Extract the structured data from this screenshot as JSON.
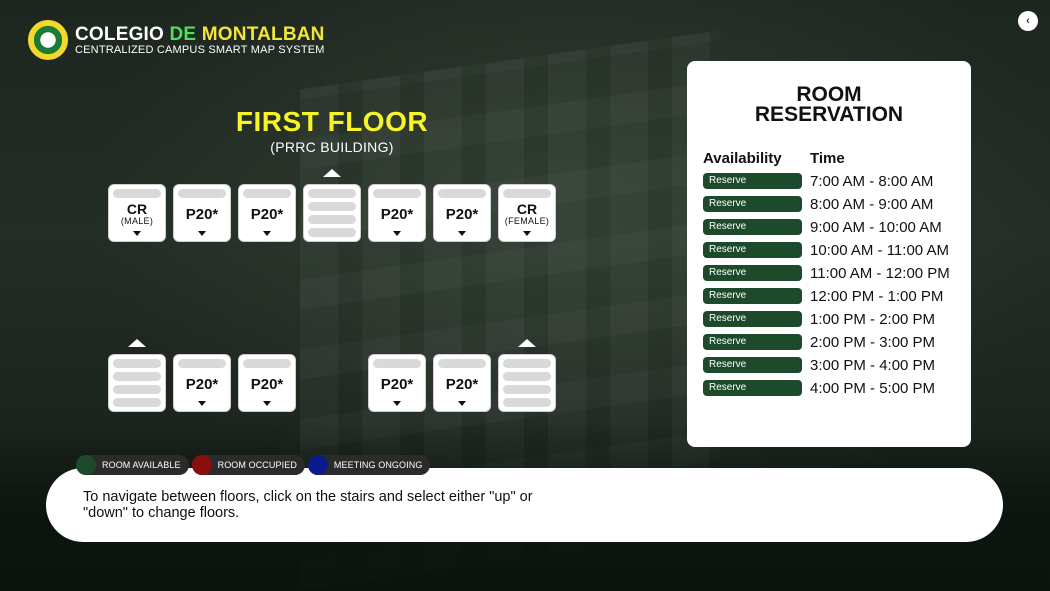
{
  "header": {
    "title_part1": "COLEGIO",
    "title_part2": "DE",
    "title_part3": "MONTALBAN",
    "subtitle": "CENTRALIZED CAMPUS SMART MAP SYSTEM",
    "logo_icon": "school-seal-icon"
  },
  "back_button": {
    "label": "‹",
    "icon": "chevron-left-icon"
  },
  "floor": {
    "name": "FIRST FLOOR",
    "building": "(PRRC BUILDING)"
  },
  "rooms_top": [
    {
      "label": "CR",
      "sub": "(MALE)"
    },
    {
      "label": "P20*"
    },
    {
      "label": "P20*"
    },
    {
      "label": "stairs"
    },
    {
      "label": "P20*"
    },
    {
      "label": "P20*"
    },
    {
      "label": "CR",
      "sub": "(FEMALE)"
    }
  ],
  "rooms_bottom": [
    {
      "label": "stairs"
    },
    {
      "label": "P20*"
    },
    {
      "label": "P20*"
    },
    {
      "label": "P20*"
    },
    {
      "label": "P20*"
    },
    {
      "label": "stairs"
    }
  ],
  "reservation": {
    "title_line1": "ROOM",
    "title_line2": "RESERVATION",
    "col_availability": "Availability",
    "col_time": "Time",
    "button_label": "Reserve",
    "slots": [
      "7:00 AM - 8:00 AM",
      "8:00 AM - 9:00 AM",
      "9:00 AM - 10:00 AM",
      "10:00 AM - 11:00 AM",
      "11:00 AM - 12:00 PM",
      "12:00 PM - 1:00 PM",
      "1:00 PM - 2:00 PM",
      "2:00 PM - 3:00 PM",
      "3:00 PM - 4:00 PM",
      "4:00 PM - 5:00 PM"
    ]
  },
  "legend": [
    {
      "label": "ROOM AVAILABLE",
      "color": "#1e4a2c"
    },
    {
      "label": "ROOM OCCUPIED",
      "color": "#8b0e0e"
    },
    {
      "label": "MEETING ONGOING",
      "color": "#0d1a8c"
    }
  ],
  "info": {
    "text": "To navigate between floors, click on the stairs and select either \"up\" or \"down\" to change floors."
  },
  "colors": {
    "accent_yellow": "#f7f52a",
    "accent_green": "#4ee05a",
    "reserve_green": "#1e4a2c"
  }
}
